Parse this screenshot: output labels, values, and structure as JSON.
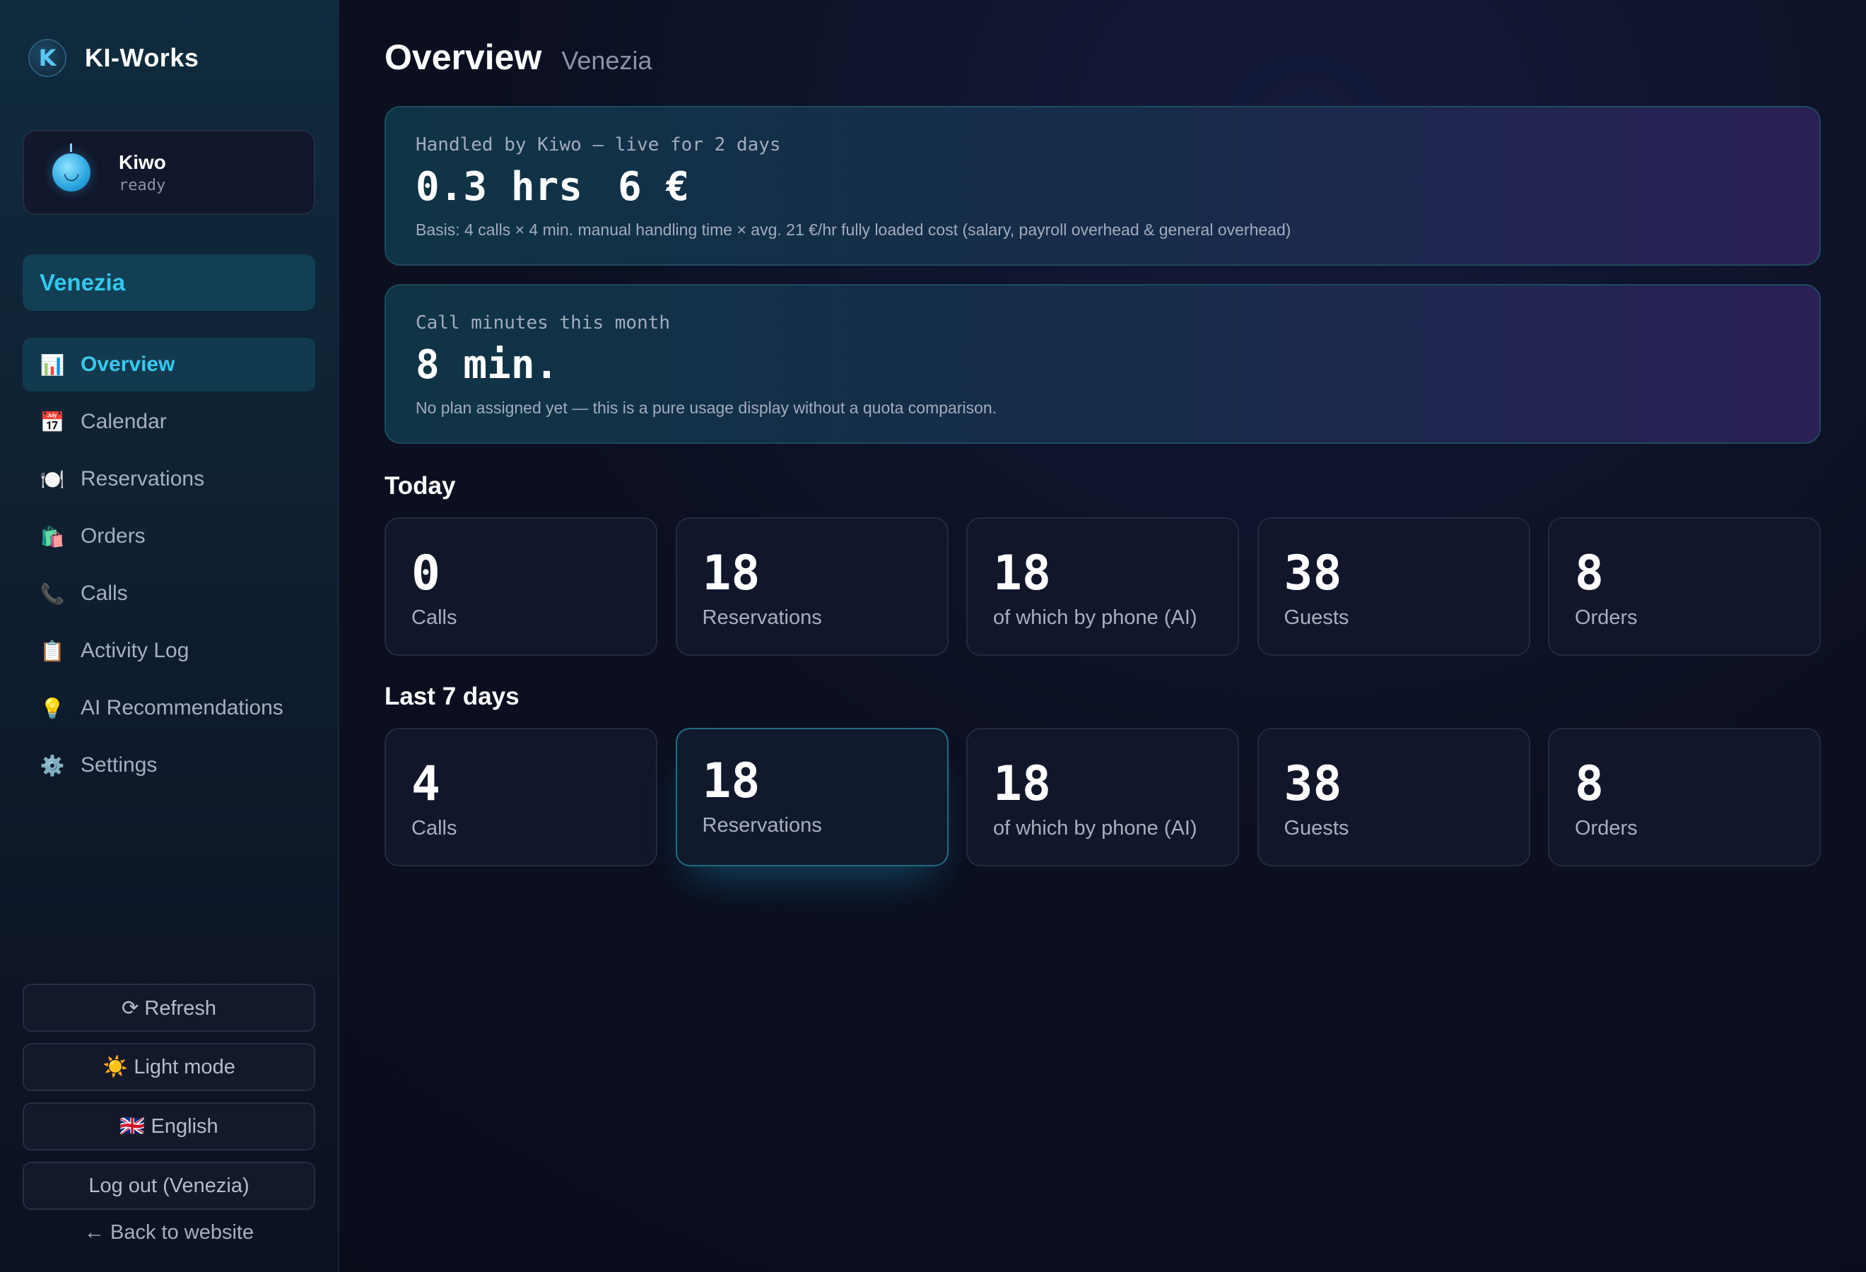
{
  "app": {
    "brand_name": "KI-Works",
    "brand_letter": "K"
  },
  "assistant": {
    "name": "Kiwo",
    "status": "ready"
  },
  "venue": "Venezia",
  "nav": [
    {
      "icon": "📊",
      "icon_name": "bar-chart-icon",
      "label": "Overview",
      "active": true
    },
    {
      "icon": "📅",
      "icon_name": "calendar-icon",
      "label": "Calendar"
    },
    {
      "icon": "🍽️",
      "icon_name": "plate-icon",
      "label": "Reservations"
    },
    {
      "icon": "🛍️",
      "icon_name": "shopping-bag-icon",
      "label": "Orders"
    },
    {
      "icon": "📞",
      "icon_name": "phone-icon",
      "label": "Calls"
    },
    {
      "icon": "📋",
      "icon_name": "clipboard-icon",
      "label": "Activity Log"
    },
    {
      "icon": "💡",
      "icon_name": "lightbulb-icon",
      "label": "AI Recommendations"
    },
    {
      "icon": "⚙️",
      "icon_name": "gear-icon",
      "label": "Settings"
    }
  ],
  "sidebar_actions": {
    "refresh": "⟳ Refresh",
    "theme": "☀️ Light mode",
    "language": "🇬🇧 English",
    "logout": "Log out (Venezia)",
    "back": "← Back to website"
  },
  "header": {
    "title": "Overview",
    "subtitle": "Venezia"
  },
  "savings": {
    "label": "Handled by Kiwo — live for 2 days",
    "hours": "0.3 hrs",
    "euros": "6 €",
    "note": "Basis: 4 calls × 4 min. manual handling time × avg. 21 €/hr fully loaded cost (salary, payroll overhead & general overhead)"
  },
  "minutes": {
    "label": "Call minutes this month",
    "value": "8 min.",
    "note": "No plan assigned yet — this is a pure usage display without a quota comparison."
  },
  "today": {
    "title": "Today",
    "stats": [
      {
        "value": "0",
        "label": "Calls"
      },
      {
        "value": "18",
        "label": "Reservations"
      },
      {
        "value": "18",
        "label": "of which by phone (AI)"
      },
      {
        "value": "38",
        "label": "Guests"
      },
      {
        "value": "8",
        "label": "Orders"
      }
    ]
  },
  "last7": {
    "title": "Last 7 days",
    "stats": [
      {
        "value": "4",
        "label": "Calls"
      },
      {
        "value": "18",
        "label": "Reservations"
      },
      {
        "value": "18",
        "label": "of which by phone (AI)"
      },
      {
        "value": "38",
        "label": "Guests"
      },
      {
        "value": "8",
        "label": "Orders"
      }
    ]
  },
  "colors": {
    "accent": "#37c9ef",
    "background": "#0a0d1a",
    "card": "#12162a"
  }
}
